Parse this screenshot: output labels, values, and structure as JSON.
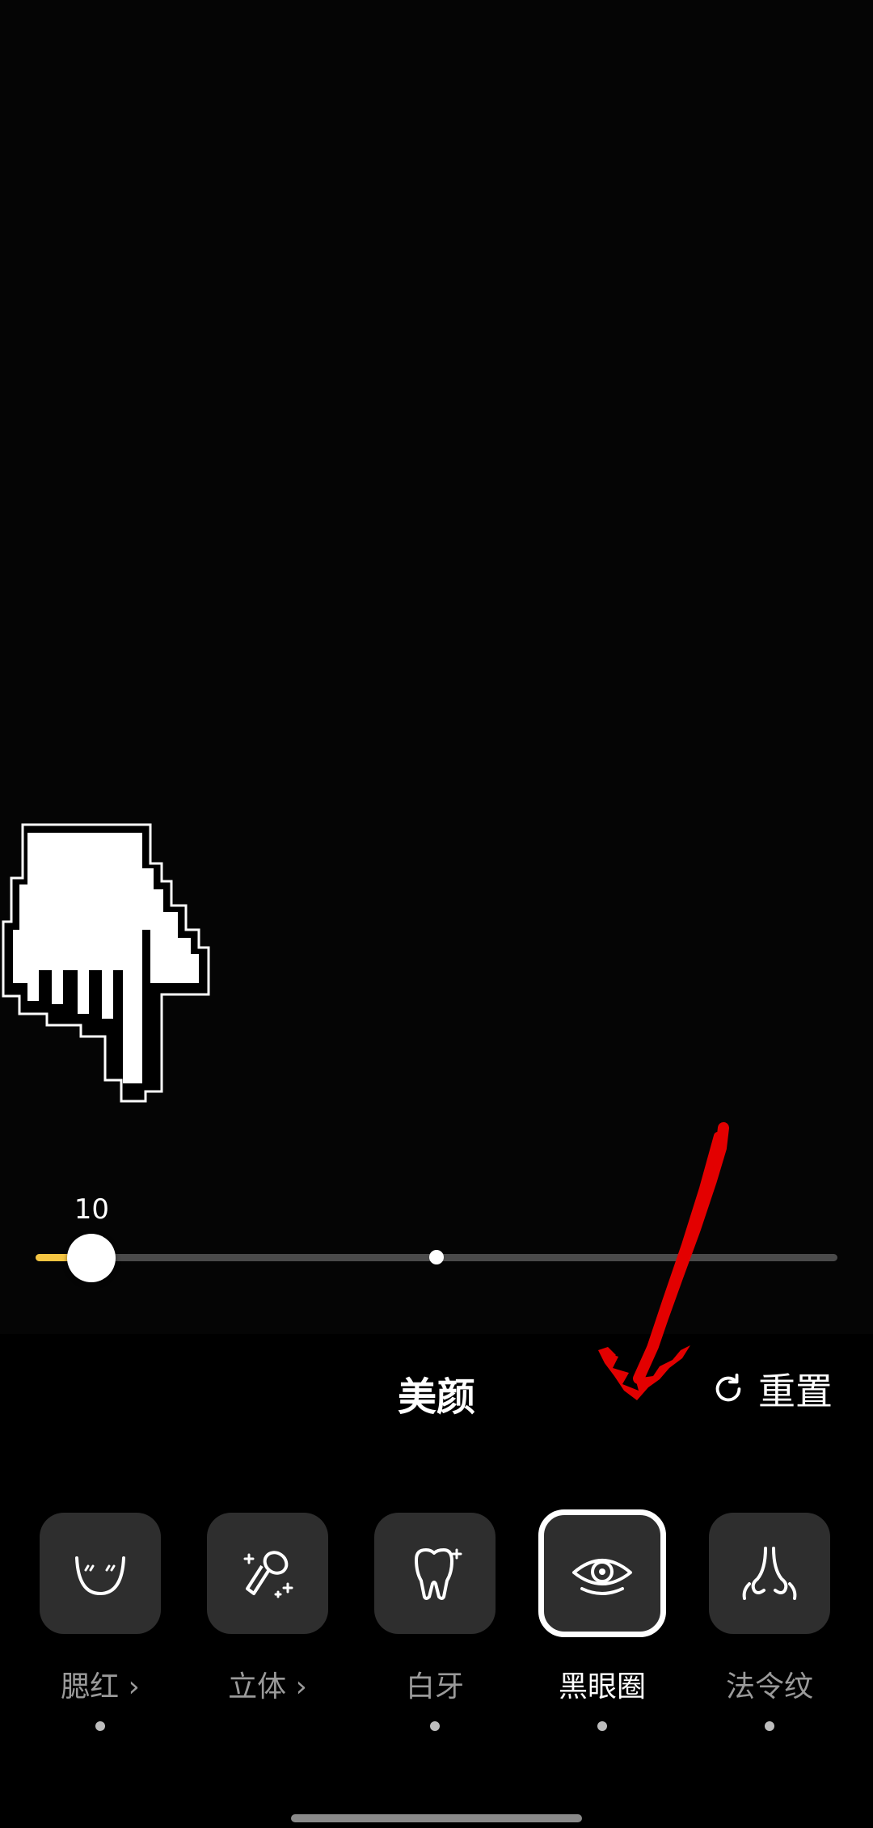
{
  "slider": {
    "value_label": "10",
    "value_fraction": 0.07,
    "fill_color": "#f5c542"
  },
  "panel": {
    "title": "美颜",
    "reset_label": "重置",
    "reset_icon": "refresh-icon"
  },
  "tools": [
    {
      "label": "腮红 ›",
      "icon": "blush-icon",
      "active": false,
      "dot": true
    },
    {
      "label": "立体 ›",
      "icon": "contour-brush-icon",
      "active": false,
      "dot": false
    },
    {
      "label": "白牙",
      "icon": "tooth-sparkle-icon",
      "active": false,
      "dot": true
    },
    {
      "label": "黑眼圈",
      "icon": "eye-icon",
      "active": true,
      "dot": true
    },
    {
      "label": "法令纹",
      "icon": "nose-icon",
      "active": false,
      "dot": true
    }
  ],
  "overlays": {
    "hand_icon": "pointing-hand-icon",
    "arrow_icon": "red-arrow-icon",
    "arrow_color": "#e30000"
  }
}
